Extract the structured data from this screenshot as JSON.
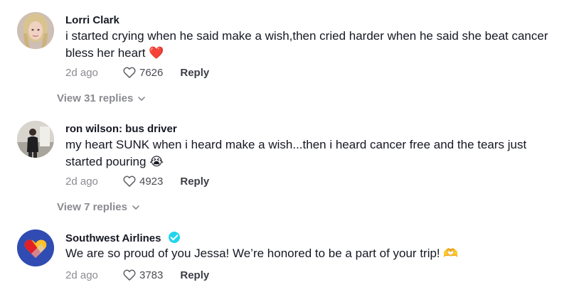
{
  "comments": [
    {
      "user": "Lorri Clark",
      "verified": false,
      "text": "i started crying when he said make a wish,then cried harder when he said she beat cancer bless her heart",
      "emoji": "❤️",
      "time": "2d ago",
      "likes": "7626",
      "reply_label": "Reply",
      "view_replies": "View 31 replies"
    },
    {
      "user": "ron wilson: bus driver",
      "verified": false,
      "text": "my heart SUNK when i heard make a wish...then i heard cancer free and the tears just started pouring",
      "emoji": "😭",
      "time": "2d ago",
      "likes": "4923",
      "reply_label": "Reply",
      "view_replies": "View 7 replies"
    },
    {
      "user": "Southwest Airlines",
      "verified": true,
      "text": "We are so proud of you Jessa! We’re honored to be a part of your trip!",
      "emoji": "🫶",
      "time": "2d ago",
      "likes": "3783",
      "reply_label": "Reply"
    }
  ],
  "icons": {
    "like": "heart-outline-icon",
    "expand": "chevron-down-icon",
    "verified": "verified-badge-icon"
  },
  "colors": {
    "secondary_text": "#8a8b91",
    "verified": "#20d5ec",
    "southwest_blue": "#304cb2",
    "southwest_red": "#e21f26",
    "southwest_yellow": "#ffbf27"
  }
}
